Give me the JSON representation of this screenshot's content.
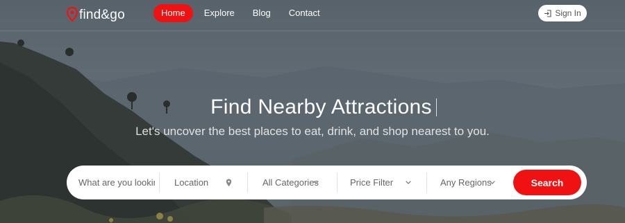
{
  "brand": {
    "name": "find&go",
    "accent": "#f01212"
  },
  "nav": {
    "items": [
      {
        "label": "Home",
        "active": true
      },
      {
        "label": "Explore",
        "active": false
      },
      {
        "label": "Blog",
        "active": false
      },
      {
        "label": "Contact",
        "active": false
      }
    ],
    "signin_label": "Sign In",
    "signin_icon": "sign-in-icon"
  },
  "hero": {
    "title": "Find Nearby Attractions",
    "subtitle": "Let's uncover the best places to eat, drink, and shop nearest to you."
  },
  "search": {
    "what_placeholder": "What are you lookin",
    "location_label": "Location",
    "location_icon": "map-pin-icon",
    "category_label": "All Categories",
    "price_label": "Price Filter",
    "region_label": "Any Regions",
    "button_label": "Search"
  }
}
